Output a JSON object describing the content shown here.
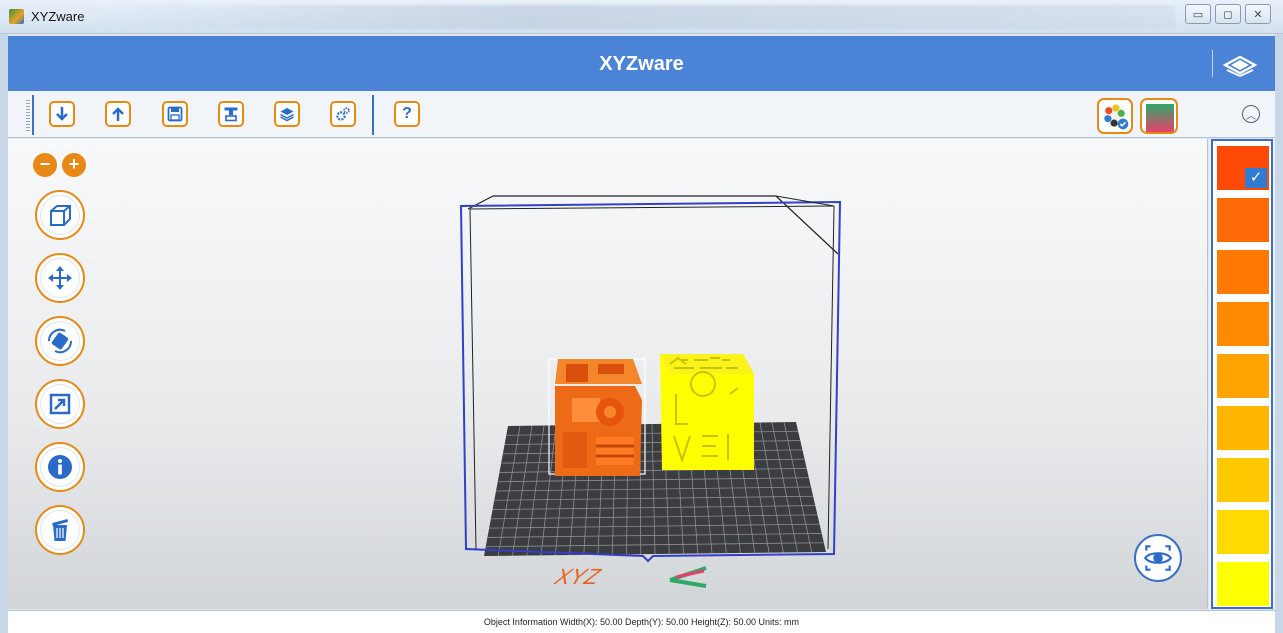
{
  "window": {
    "title": "XYZware",
    "controls": [
      "minimize",
      "maximize",
      "close"
    ]
  },
  "header": {
    "app_title": "XYZware"
  },
  "toolbar": {
    "help_label": "?",
    "buttons": [
      "import",
      "export",
      "save",
      "print",
      "layers",
      "settings",
      "help"
    ],
    "right_buttons": [
      "color-mode",
      "gradient"
    ]
  },
  "viewport": {
    "zoom_out_label": "−",
    "zoom_in_label": "+",
    "side_tools": [
      "view-cube",
      "move",
      "rotate",
      "scale",
      "info",
      "delete"
    ],
    "brand_text": "XYZ"
  },
  "palette": {
    "colors": [
      "#ff4a06",
      "#ff6a06",
      "#ff7a04",
      "#ff8a02",
      "#ffa400",
      "#ffb600",
      "#ffc800",
      "#ffd900",
      "#ffff00"
    ],
    "selected_index": 0,
    "check_label": "✓"
  },
  "statusbar": {
    "text": "Object Information  Width(X): 50.00  Depth(Y): 50.00  Height(Z): 50.00    Units: mm"
  }
}
